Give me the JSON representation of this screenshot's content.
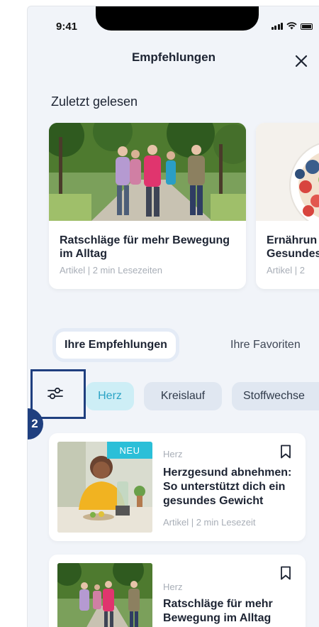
{
  "status_bar": {
    "time": "9:41"
  },
  "header": {
    "title": "Empfehlungen",
    "close_icon": "close-icon"
  },
  "recent": {
    "title": "Zuletzt gelesen",
    "cards": [
      {
        "title": "Ratschläge für mehr Bewegung\nim Alltag",
        "meta": "Artikel | 2 min Lesezeiten"
      },
      {
        "title": "Ernährun\nGesundes",
        "meta": "Artikel | 2"
      }
    ]
  },
  "tabs": [
    {
      "label": "Ihre Empfehlungen",
      "active": true
    },
    {
      "label": "Ihre Favoriten",
      "active": false
    }
  ],
  "filter": {
    "icon": "filter-sliders-icon",
    "badge": "2"
  },
  "chips": [
    {
      "label": "Herz",
      "selected": true
    },
    {
      "label": "Kreislauf",
      "selected": false
    },
    {
      "label": "Stoffwechse",
      "selected": false
    }
  ],
  "recommendations": [
    {
      "badge": "NEU",
      "category": "Herz",
      "title": "Herzgesund abnehmen:\nSo unterstützt dich ein\ngesundes Gewicht",
      "meta": "Artikel  | 2 min  Lesezeit"
    },
    {
      "category": "Herz",
      "title": "Ratschläge für mehr\nBewegung im Alltag"
    }
  ],
  "colors": {
    "background": "#f1f4f9",
    "accent_cyan": "#2bbfd8",
    "chip_selected_bg": "#cdeef6",
    "highlight_navy": "#1f3f7f"
  }
}
